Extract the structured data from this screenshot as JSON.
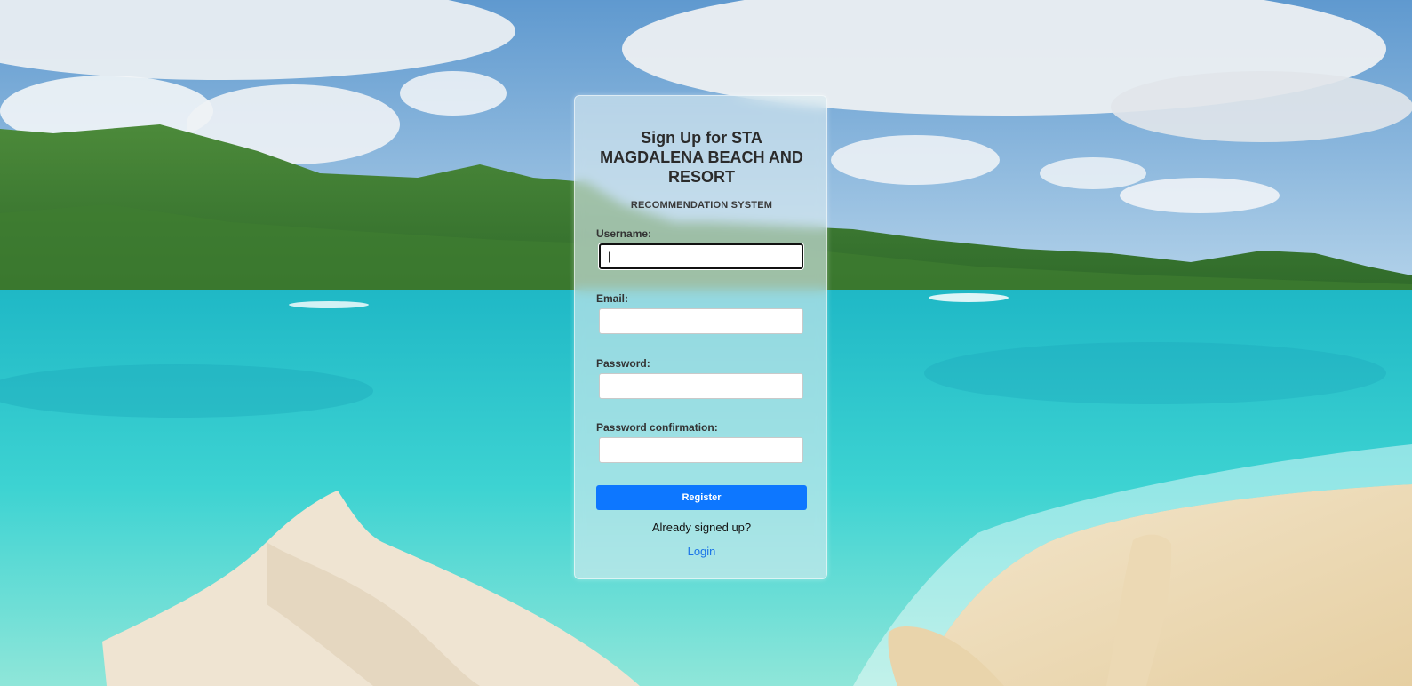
{
  "form": {
    "title": "Sign Up for STA MAGDALENA BEACH AND RESORT",
    "subtitle": "RECOMMENDATION SYSTEM",
    "fields": [
      {
        "label": "Username:",
        "value": "|",
        "placeholder": ""
      },
      {
        "label": "Email:",
        "value": "",
        "placeholder": ""
      },
      {
        "label": "Password:",
        "value": "",
        "placeholder": ""
      },
      {
        "label": "Password confirmation:",
        "value": "",
        "placeholder": ""
      }
    ],
    "register_label": "Register",
    "already_text": "Already signed up?",
    "login_label": "Login"
  },
  "colors": {
    "accent": "#0d77ff",
    "link": "#1a73e8",
    "card_background": "rgba(220,236,240,0.62)"
  },
  "icons": {
    "background": "beach-scene-image"
  }
}
